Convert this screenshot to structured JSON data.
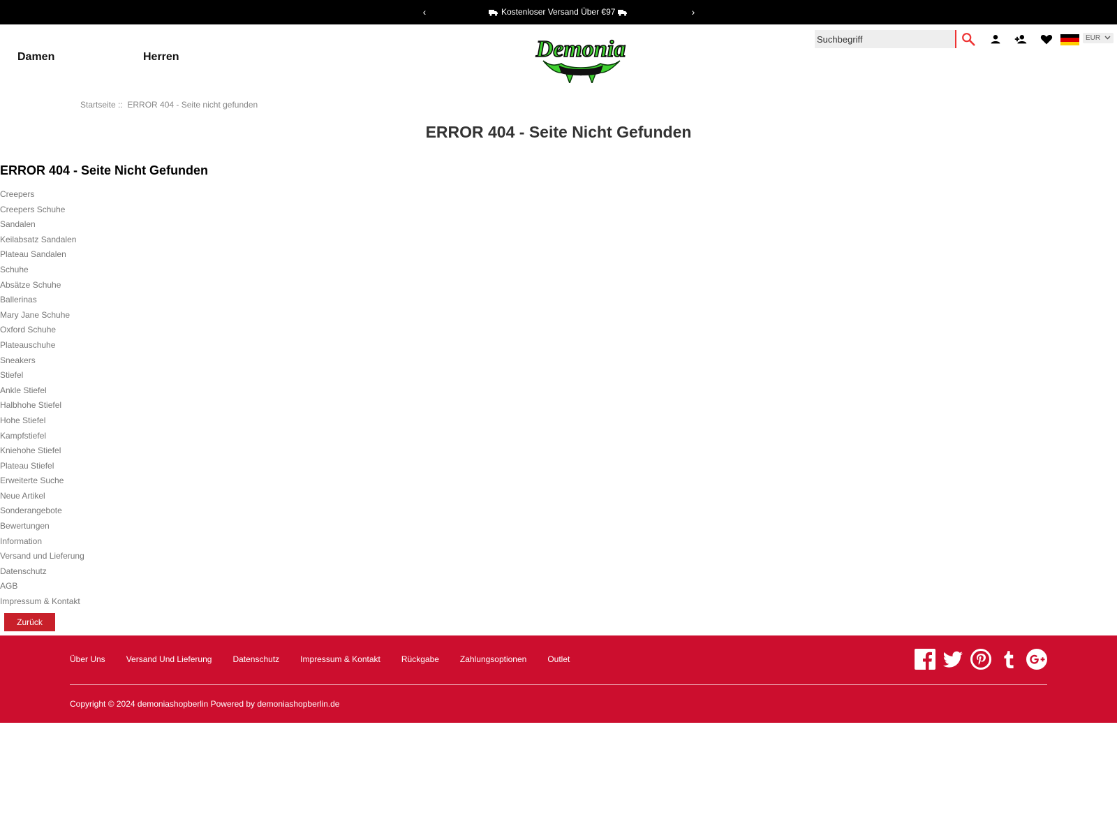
{
  "announcement": {
    "prev_label": "‹",
    "next_label": "›",
    "text": "Kostenloser Versand Über €97"
  },
  "nav": {
    "damen": "Damen",
    "herren": "Herren"
  },
  "logo": {
    "text": "Demonia"
  },
  "search": {
    "placeholder": "Suchbegriff"
  },
  "currency": {
    "selected": "EUR"
  },
  "icons": {
    "search": "search-icon",
    "account": "person-icon",
    "register": "person-add-icon",
    "wishlist": "heart-icon",
    "language": "german-flag-icon"
  },
  "breadcrumb": {
    "home": "Startseite",
    "separator": "::",
    "current": "ERROR 404 - Seite nicht gefunden"
  },
  "page": {
    "title": "ERROR 404 - Seite Nicht Gefunden",
    "subtitle": "ERROR 404 - Seite Nicht Gefunden",
    "back_button": "Zurück"
  },
  "categories": [
    "Creepers",
    "Creepers Schuhe",
    "Sandalen",
    "Keilabsatz Sandalen",
    "Plateau Sandalen",
    "Schuhe",
    "Absätze Schuhe",
    "Ballerinas",
    "Mary Jane Schuhe",
    "Oxford Schuhe",
    "Plateauschuhe",
    "Sneakers",
    "Stiefel",
    "Ankle Stiefel",
    "Halbhohe Stiefel",
    "Hohe Stiefel",
    "Kampfstiefel",
    "Kniehohe Stiefel",
    "Plateau Stiefel",
    "Erweiterte Suche",
    "Neue Artikel",
    "Sonderangebote",
    "Bewertungen",
    "Information",
    "Versand und Lieferung",
    "Datenschutz",
    "AGB",
    "Impressum & Kontakt"
  ],
  "footer": {
    "links": [
      "Über Uns",
      "Versand Und Lieferung",
      "Datenschutz",
      "Impressum & Kontakt",
      "Rückgabe",
      "Zahlungsoptionen",
      "Outlet"
    ],
    "social": [
      "facebook-icon",
      "twitter-icon",
      "pinterest-icon",
      "tumblr-icon",
      "google-plus-icon"
    ],
    "copyright": "Copyright © 2024 demoniashopberlin Powered by demoniashopberlin.de"
  },
  "colors": {
    "topbar": "#000000",
    "accent": "#cc0e2e",
    "button": "#c8202a",
    "logo_green": "#3fd130"
  }
}
